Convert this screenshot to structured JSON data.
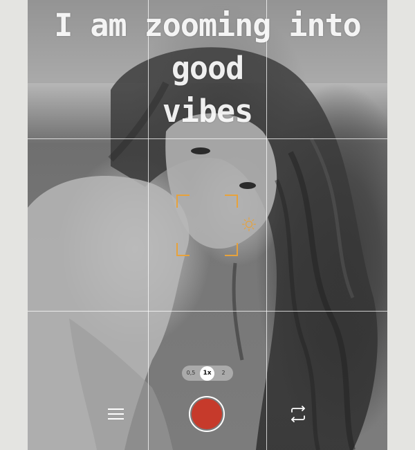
{
  "caption": {
    "line1": "I am zooming into good",
    "line2": "vibes"
  },
  "zoom": {
    "options": [
      "0,5",
      "1x",
      "2"
    ],
    "selected": "1x"
  },
  "icons": {
    "menu": "menu-icon",
    "shutter": "record-icon",
    "flip": "flip-camera-icon",
    "exposure": "sun-icon"
  },
  "colors": {
    "focus": "#e7a23b",
    "shutter": "#c63a2b",
    "grid": "#ffffff"
  }
}
